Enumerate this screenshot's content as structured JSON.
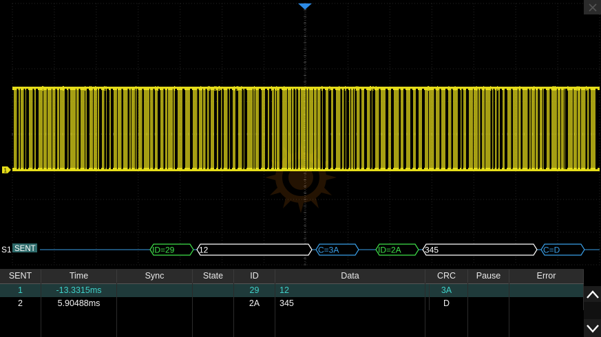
{
  "bus_label": "S1",
  "protocol_tag": "SENT",
  "decode_frames": [
    {
      "text": "ID=29",
      "kind": "id"
    },
    {
      "text": "12",
      "kind": "data"
    },
    {
      "text": "C=3A",
      "kind": "crc"
    },
    {
      "text": "ID=2A",
      "kind": "id"
    },
    {
      "text": "345",
      "kind": "data"
    },
    {
      "text": "C=D",
      "kind": "crc"
    }
  ],
  "trigger_marker": "T",
  "channel_marker": "1",
  "colors": {
    "trace": "#e6dd1a",
    "id": "#3fe14a",
    "data": "#ffffff",
    "crc": "#3a9fe8",
    "bus_line": "#3a9fe8",
    "selected_row": "#3fd0c8"
  },
  "table": {
    "columns": [
      "SENT",
      "Time",
      "Sync",
      "State",
      "ID",
      "Data",
      "CRC",
      "Pause",
      "Error"
    ],
    "rows": [
      {
        "sent": "1",
        "time": "-13.3315ms",
        "sync": "",
        "state": "",
        "id": "29",
        "data": "12",
        "crc": "3A",
        "pause": "",
        "error": "",
        "selected": true
      },
      {
        "sent": "2",
        "time": "5.90488ms",
        "sync": "",
        "state": "",
        "id": "2A",
        "data": "345",
        "crc": "D",
        "pause": "",
        "error": "",
        "selected": false
      }
    ]
  }
}
